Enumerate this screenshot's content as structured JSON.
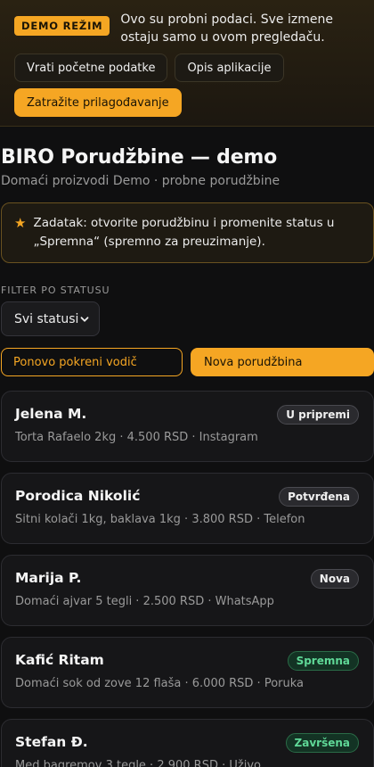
{
  "banner": {
    "badge": "DEMO REŽIM",
    "text": "Ovo su probni podaci. Sve izmene ostaju samo u ovom pregledaču.",
    "reset_label": "Vrati početne podatke",
    "about_label": "Opis aplikacije",
    "request_label": "Zatražite prilagođavanje"
  },
  "page": {
    "title": "BIRO Porudžbine — demo",
    "subtitle": "Domaći proizvodi Demo · probne porudžbine"
  },
  "task": {
    "text": "Zadatak: otvorite porudžbinu i promenite status u „Spremna“ (spremno za preuzimanje)."
  },
  "filter": {
    "label": "FILTER PO STATUSU",
    "selected": "Svi statusi"
  },
  "actions": {
    "guide_label": "Ponovo pokreni vodič",
    "new_label": "Nova porudžbina"
  },
  "orders": [
    {
      "name": "Jelena M.",
      "meta": "Torta Rafaelo 2kg · 4.500 RSD · Instagram",
      "status": "U pripremi",
      "status_color": "#2a2a2e"
    },
    {
      "name": "Porodica Nikolić",
      "meta": "Sitni kolači 1kg, baklava 1kg · 3.800 RSD · Telefon",
      "status": "Potvrđena",
      "status_color": "#2a2a2e"
    },
    {
      "name": "Marija P.",
      "meta": "Domaći ajvar 5 tegli · 2.500 RSD · WhatsApp",
      "status": "Nova",
      "status_color": "#2a2a2e"
    },
    {
      "name": "Kafić Ritam",
      "meta": "Domaći sok od zove 12 flaša · 6.000 RSD · Poruka",
      "status": "Spremna",
      "status_color": "#133324"
    },
    {
      "name": "Stefan Đ.",
      "meta": "Med bagremov 3 tegle · 2.900 RSD · Uživo",
      "status": "Završena",
      "status_color": "#133324"
    }
  ],
  "colors": {
    "accent": "#f5a623",
    "background": "#0f0f10",
    "success": "#5fd897"
  }
}
